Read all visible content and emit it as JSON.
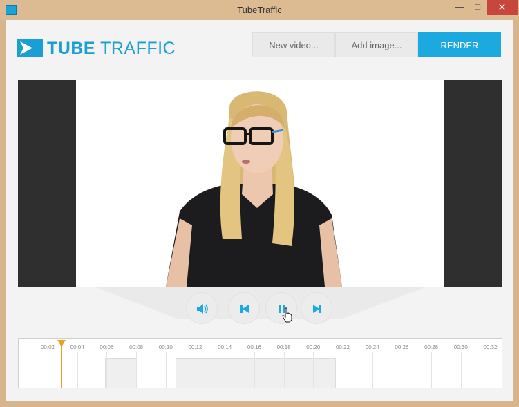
{
  "window": {
    "title": "TubeTraffic",
    "minimize_label": "—",
    "maximize_label": "□",
    "close_label": "✕"
  },
  "brand": {
    "name_bold": "TUBE",
    "name_light": "TRAFFIC",
    "color": "#1a9fd4"
  },
  "toolbar": {
    "new_video_label": "New video...",
    "add_image_label": "Add image...",
    "render_label": "RENDER",
    "render_color": "#1ba9e0"
  },
  "player": {
    "controls": [
      "volume-icon",
      "skip-back-icon",
      "pause-icon",
      "skip-forward-icon"
    ]
  },
  "timeline": {
    "ticks": [
      "00:02",
      "00:04",
      "00:06",
      "00:08",
      "00:10",
      "00:12",
      "00:14",
      "00:16",
      "00:18",
      "00:20",
      "00:22",
      "00:24",
      "00:26",
      "00:28",
      "00:30",
      "00:32"
    ],
    "playhead_color": "#f0a020"
  }
}
